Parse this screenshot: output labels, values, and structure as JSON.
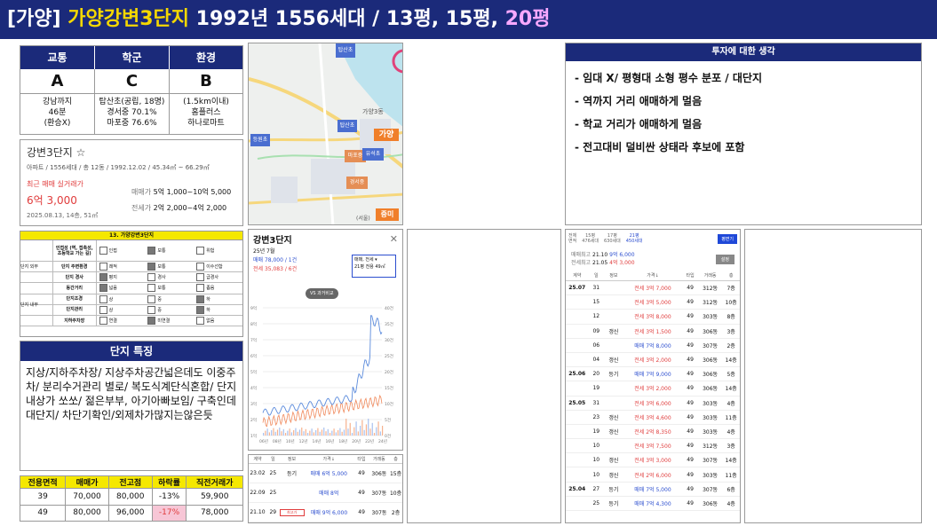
{
  "header": {
    "prefix": "[가양] ",
    "name": "가양강변3단지",
    "mid": " 1992년 1556세대 / 13평, 15평, ",
    "hl": "20평"
  },
  "summary": {
    "heads": [
      "교통",
      "학군",
      "환경"
    ],
    "grades": [
      "A",
      "C",
      "B"
    ],
    "details": [
      [
        "강남까지",
        "46분",
        "(환승X)"
      ],
      [
        "탑산초(공립, 18명)",
        "경서중 70.1%",
        "마포중 76.6%"
      ],
      [
        "(1.5km이내)",
        "홈플러스",
        "하나로마트"
      ]
    ]
  },
  "complex": {
    "title": "강변3단지 ☆",
    "info": "아파트 / 1556세대 / 총 12동 / 1992.12.02 / 45.34㎡ ~ 66.29㎡",
    "recent_label": "최근 매매 실거래가",
    "recent_price": "6억 3,000",
    "recent_date": "2025.08.13, 14층, 51㎡",
    "sale_label": "매매가",
    "sale_range": "5억 1,000~10억 5,000",
    "jeonse_label": "전세가",
    "jeonse_range": "2억 2,000~4억 2,000"
  },
  "eval": {
    "title": "13. 가양강변3단지",
    "groups": [
      "단지 외부",
      "단지 내부"
    ],
    "rows": [
      {
        "label": "인접성 (역, 접촉성, 초등학교 가는 길)",
        "opts": [
          "인접",
          "보통",
          "위험"
        ],
        "sel": 1
      },
      {
        "label": "단지 주변환경",
        "opts": [
          "쾌적",
          "보통",
          "이수선함"
        ],
        "sel": 1
      },
      {
        "label": "단지 경사",
        "opts": [
          "평지",
          "경사",
          "급경사"
        ],
        "sel": 0
      },
      {
        "label": "동간거리",
        "opts": [
          "넓음",
          "보통",
          "좁음"
        ],
        "sel": 0
      },
      {
        "label": "단지조경",
        "opts": [
          "상",
          "중",
          "하"
        ],
        "sel": 2
      },
      {
        "label": "단지관리",
        "opts": [
          "상",
          "중",
          "하"
        ],
        "sel": 2
      },
      {
        "label": "지하주차장",
        "opts": [
          "연결",
          "미연결",
          "없음"
        ],
        "sel": 1
      }
    ]
  },
  "features": {
    "title": "단지 특징",
    "text": "지상/지하주차장/ 지상주차공간넓은데도 이중주차/ 분리수거관리 별로/ 복도식계단식혼합/ 단지내상가 쏘쏘/ 젊은부부, 아기아빠보임/ 구축인데 대단지/ 차단기확인/외제차가많지는않은듯"
  },
  "price_table": {
    "headers": [
      "전용면적",
      "매매가",
      "전고점",
      "하락률",
      "직전거래가"
    ],
    "rows": [
      [
        "39",
        "70,000",
        "80,000",
        "-13%",
        "59,900"
      ],
      [
        "49",
        "80,000",
        "96,000",
        "-17%",
        "78,000"
      ]
    ]
  },
  "map": {
    "labels": [
      "탑산초",
      "가양",
      "마포중",
      "유석초",
      "등원초",
      "경서중",
      "탑산초",
      "증미",
      "가양3동",
      "(서울)"
    ]
  },
  "chart": {
    "title": "강변3단지",
    "month": "25년 7월",
    "sale": "매매 78,000 / 1건",
    "jeonse": "전세 35,083 / 6건",
    "compare": "VS 과거비교",
    "legend1": "매매, 전세 ▾",
    "legend2": "21평",
    "legend3": "전용 49㎡",
    "yl": [
      "9억",
      "8억",
      "7억",
      "6억",
      "5억",
      "4억",
      "3억",
      "2억",
      "1억"
    ],
    "yr": [
      "40건",
      "35건",
      "30건",
      "25건",
      "20건",
      "15건",
      "10건",
      "5건",
      "0건"
    ],
    "xl": [
      "06년",
      "08년",
      "10년",
      "12년",
      "14년",
      "16년",
      "18년",
      "20년",
      "22년",
      "24년"
    ]
  },
  "small_table": {
    "headers": [
      "계약",
      "일",
      "정보",
      "가격↓",
      "타입",
      "거래동",
      "층"
    ],
    "rows": [
      [
        "23.02",
        "25",
        "등기",
        "매매 6억 5,000",
        "49",
        "306동",
        "15층"
      ],
      [
        "22.09",
        "25",
        "",
        "매매 8억",
        "49",
        "307동",
        "10층"
      ],
      [
        "21.10",
        "29",
        "최고가",
        "매매 9억 6,000",
        "49",
        "307동",
        "2층"
      ]
    ]
  },
  "thoughts": {
    "title": "투자에 대한 생각",
    "items": [
      "- 임대 X/ 평형대 소형 평수 분포 / 대단지",
      "- 역까지 거리 애매하게 멀음",
      "- 학교 거리가 애매하게 멀음",
      "- 전고대비 덜비싼 상태라 후보에 포함"
    ]
  },
  "tx": {
    "tabs": [
      [
        "전체",
        "면적"
      ],
      [
        "15평",
        "476세대"
      ],
      [
        "17평",
        "630세대"
      ],
      [
        "21평",
        "450세대"
      ]
    ],
    "btn": "평면기",
    "high1_label": "매매최고",
    "high1": "21.10",
    "high1v": "9억 6,000",
    "high2_label": "전세최고",
    "high2": "21.05",
    "high2v": "4억 3,000",
    "btn2": "설정",
    "headers": [
      "계약",
      "일",
      "정보",
      "가격↓",
      "타입",
      "거래동",
      "층"
    ],
    "rows": [
      [
        "25.07",
        "31",
        "",
        "전세 3억 7,000",
        "49",
        "312동",
        "7층"
      ],
      [
        "",
        "15",
        "",
        "전세 3억 5,000",
        "49",
        "312동",
        "10층"
      ],
      [
        "",
        "12",
        "",
        "전세 3억 8,000",
        "49",
        "303동",
        "8층"
      ],
      [
        "",
        "09",
        "갱신",
        "전세 3억 1,500",
        "49",
        "306동",
        "3층"
      ],
      [
        "",
        "06",
        "",
        "매매 7억 8,000",
        "49",
        "307동",
        "2층"
      ],
      [
        "",
        "04",
        "갱신",
        "전세 3억 2,000",
        "49",
        "306동",
        "14층"
      ],
      [
        "25.06",
        "20",
        "등기",
        "매매 7억 9,000",
        "49",
        "306동",
        "5층"
      ],
      [
        "",
        "19",
        "",
        "전세 3억 2,000",
        "49",
        "306동",
        "14층"
      ],
      [
        "25.05",
        "31",
        "",
        "전세 3억 6,000",
        "49",
        "303동",
        "4층"
      ],
      [
        "",
        "23",
        "갱신",
        "전세 3억 4,600",
        "49",
        "303동",
        "11층"
      ],
      [
        "",
        "19",
        "갱신",
        "전세 2억 8,350",
        "49",
        "303동",
        "4층"
      ],
      [
        "",
        "10",
        "",
        "전세 3억 7,500",
        "49",
        "312동",
        "3층"
      ],
      [
        "",
        "10",
        "갱신",
        "전세 3억 3,000",
        "49",
        "307동",
        "14층"
      ],
      [
        "",
        "10",
        "갱신",
        "전세 2억 6,000",
        "49",
        "303동",
        "11층"
      ],
      [
        "25.04",
        "27",
        "등기",
        "매매 7억 5,000",
        "49",
        "307동",
        "6층"
      ],
      [
        "",
        "25",
        "등기",
        "매매 7억 4,300",
        "49",
        "306동",
        "4층"
      ]
    ]
  }
}
